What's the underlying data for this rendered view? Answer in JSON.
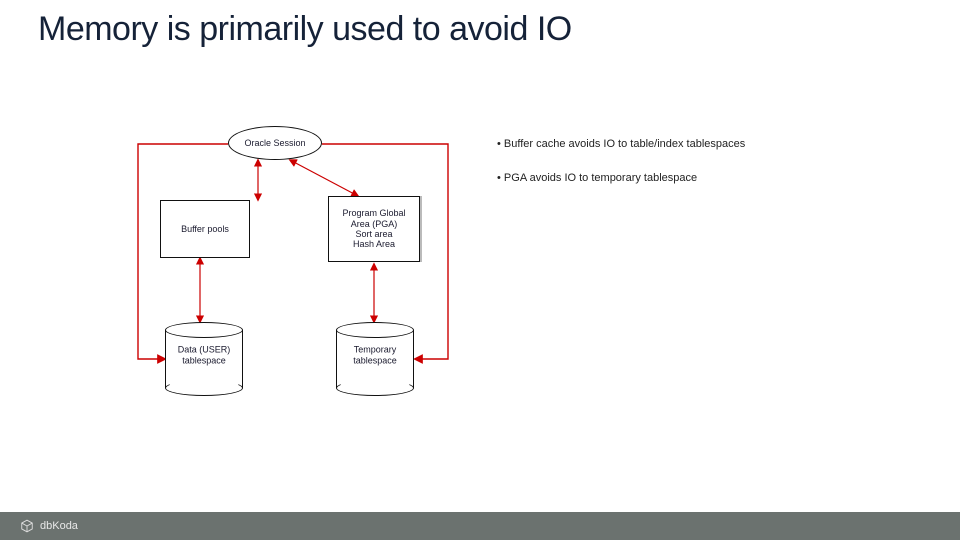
{
  "title": "Memory is primarily used to avoid IO",
  "nodes": {
    "session": "Oracle Session",
    "buffer_pools": "Buffer pools",
    "pga_l1": "Program Global",
    "pga_l2": "Area (PGA)",
    "pga_l3": "Sort area",
    "pga_l4": "Hash Area",
    "data_ts_l1": "Data (USER)",
    "data_ts_l2": "tablespace",
    "temp_ts_l1": "Temporary",
    "temp_ts_l2": "tablespace"
  },
  "bullets": {
    "b1": "Buffer cache avoids IO to table/index tablespaces",
    "b2": "PGA avoids IO to temporary tablespace"
  },
  "footer": {
    "brand": "dbKoda"
  }
}
